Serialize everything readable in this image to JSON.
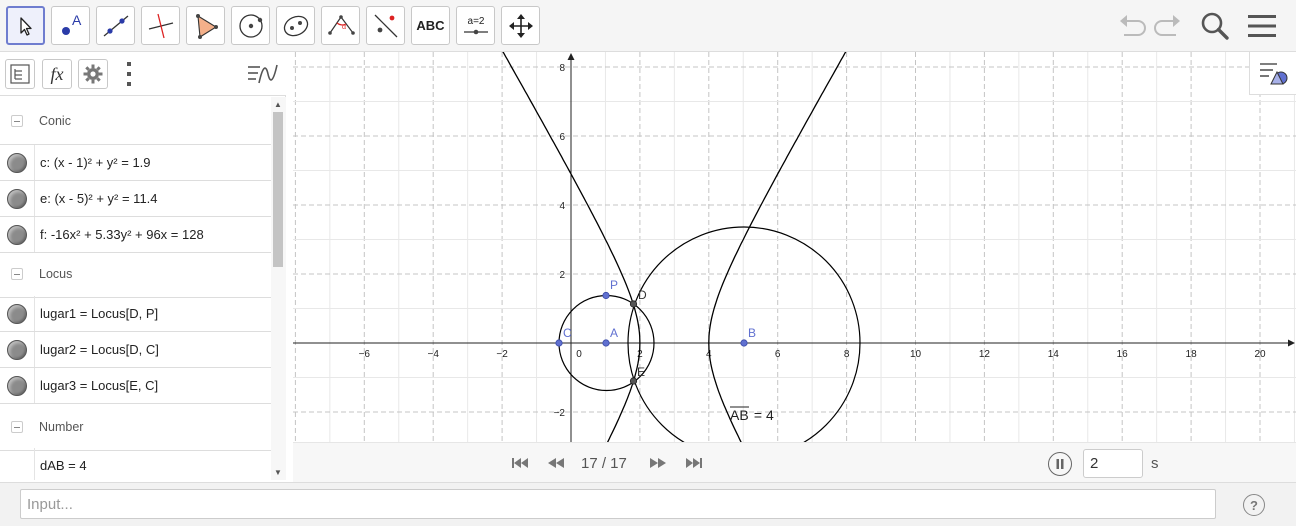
{
  "toolbar": {
    "tools": [
      {
        "id": "move",
        "icon": "arrow-pointer-icon"
      },
      {
        "id": "point",
        "icon": "point-a-icon",
        "label": "A"
      },
      {
        "id": "line",
        "icon": "line-through-points-icon"
      },
      {
        "id": "perpendicular",
        "icon": "perpendicular-line-icon"
      },
      {
        "id": "polygon",
        "icon": "polygon-icon"
      },
      {
        "id": "circle",
        "icon": "circle-center-point-icon"
      },
      {
        "id": "ellipse",
        "icon": "ellipse-icon"
      },
      {
        "id": "angle",
        "icon": "angle-icon",
        "label": "α"
      },
      {
        "id": "reflect",
        "icon": "reflect-about-line-icon"
      },
      {
        "id": "text",
        "icon": "text-tool-icon",
        "label": "ABC"
      },
      {
        "id": "slider",
        "icon": "slider-icon",
        "label": "a=2"
      },
      {
        "id": "move-graphics",
        "icon": "move-graphics-view-icon"
      }
    ],
    "right_icons": [
      "undo-icon",
      "redo-icon",
      "search-icon",
      "menu-icon"
    ]
  },
  "algebra": {
    "header_icons": [
      "tree-view-icon",
      "fx-icon",
      "gear-icon",
      "more-vertical-icon",
      "algebra-toggle-icon"
    ],
    "fx_label": "fx",
    "groups": [
      {
        "label": "Conic",
        "items": [
          "c: (x - 1)² + y² = 1.9",
          "e: (x - 5)² + y² = 11.4",
          "f: -16x² + 5.33y² + 96x = 128"
        ]
      },
      {
        "label": "Locus",
        "items": [
          "lugar1 = Locus[D, P]",
          "lugar2 = Locus[D, C]",
          "lugar3 = Locus[E, C]"
        ]
      },
      {
        "label": "Number",
        "items": [
          "dAB = 4"
        ]
      }
    ]
  },
  "graphics": {
    "x_ticks": [
      "-6",
      "-4",
      "-2",
      "0",
      "2",
      "4",
      "6",
      "8",
      "10",
      "12",
      "14",
      "16",
      "18",
      "20"
    ],
    "y_ticks": [
      "8",
      "6",
      "4",
      "2",
      "-2"
    ],
    "point_labels": {
      "A": "A",
      "B": "B",
      "C": "C",
      "D": "D",
      "E": "E",
      "P": "P"
    },
    "segment_label": "AB",
    "segment_value": " = 4",
    "curve_color": "#000000",
    "point_color": "#6070d0"
  },
  "animation": {
    "step": "17 / 17",
    "speed_value": "2",
    "speed_unit": "s",
    "icons": [
      "first-step-icon",
      "previous-step-icon",
      "next-step-icon",
      "last-step-icon",
      "pause-icon"
    ]
  },
  "input_bar": {
    "placeholder": "Input...",
    "help": "?"
  }
}
